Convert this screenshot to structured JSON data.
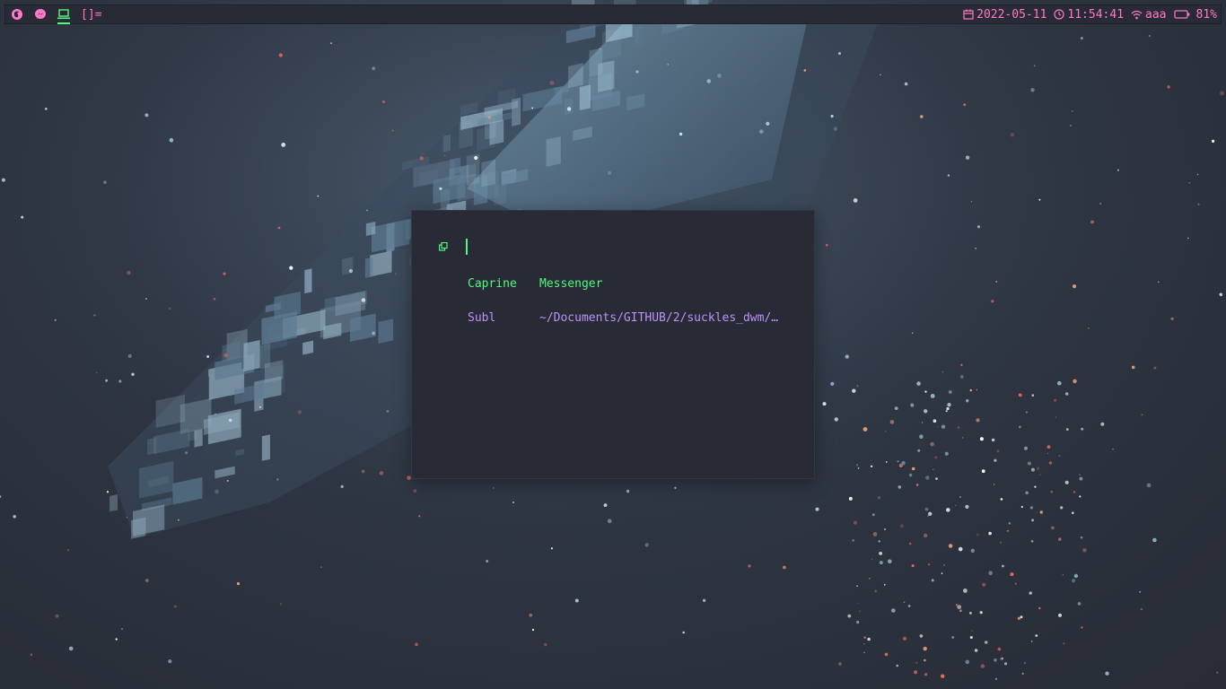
{
  "topbar": {
    "workspaces": [
      {
        "icon": "firefox-icon",
        "color": "#ff79c6",
        "active": false
      },
      {
        "icon": "messenger-icon",
        "color": "#ff79c6",
        "active": false
      },
      {
        "icon": "laptop-icon",
        "color": "#50fa7b",
        "active": true
      }
    ],
    "layout_symbol": "[]=",
    "status": {
      "date": "2022-05-11",
      "time": "11:54:41",
      "wifi_ssid": "aaa",
      "battery": "81%"
    }
  },
  "launcher": {
    "mode_icon": "window-switcher-icon",
    "query": "",
    "entries": [
      {
        "app": "Caprine",
        "title": "Messenger",
        "selected": true
      },
      {
        "app": "Subl",
        "title": "~/Documents/GITHUB/2/suckles_dwm/…",
        "selected": false
      }
    ]
  },
  "colors": {
    "accent_green": "#50fa7b",
    "accent_pink": "#ff79c6",
    "accent_purple": "#bd93f9",
    "bar_bg": "#282a36"
  }
}
